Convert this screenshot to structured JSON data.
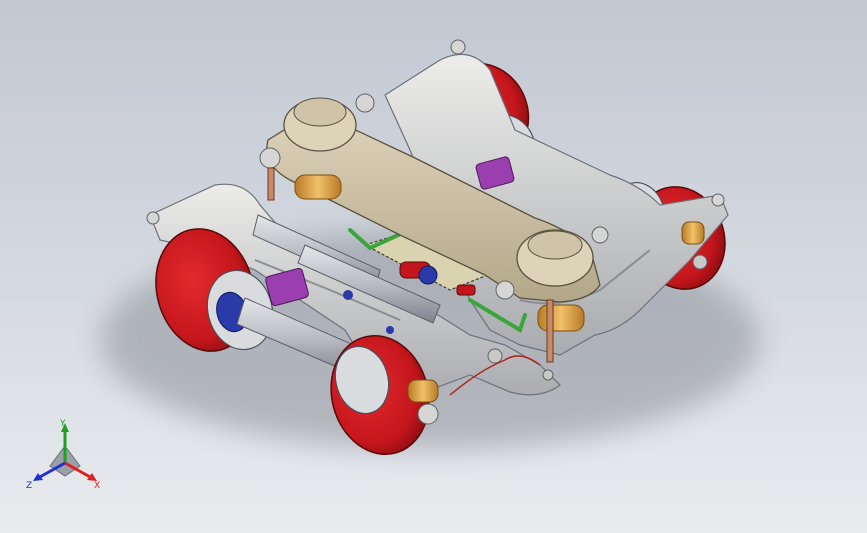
{
  "viewport": {
    "background_top": "#c2c8d2",
    "background_bottom": "#e9ebee"
  },
  "model": {
    "colors": {
      "frame": "#d6d6d4",
      "frame_shadow": "#a9abaf",
      "bolster": "#cfc4a8",
      "bolster_dark": "#b7ab8f",
      "wheel": "#c4161c",
      "wheel_dark": "#8e0e12",
      "spring": "#e0a64a",
      "axle": "#b9bcc2",
      "bearing": "#2a3aa8",
      "bracket": "#9b3fb0",
      "pipe": "#3aa53a",
      "rod": "#c98a6a"
    }
  },
  "triad": {
    "x_label": "X",
    "y_label": "Y",
    "z_label": "Z",
    "x_color": "#e02020",
    "y_color": "#20a020",
    "z_color": "#2030d0"
  }
}
